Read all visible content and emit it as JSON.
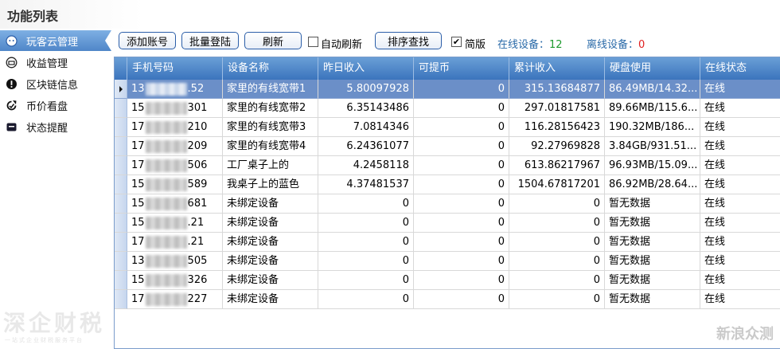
{
  "app": {
    "title": "功能列表"
  },
  "sidebar": {
    "items": [
      {
        "label": "玩客云管理",
        "icon": "cloud-icon",
        "active": true
      },
      {
        "label": "收益管理",
        "icon": "income-icon",
        "active": false
      },
      {
        "label": "区块链信息",
        "icon": "blockchain-info-icon",
        "active": false
      },
      {
        "label": "币价看盘",
        "icon": "price-chart-icon",
        "active": false
      },
      {
        "label": "状态提醒",
        "icon": "notification-icon",
        "active": false
      }
    ],
    "watermark": "深企财税",
    "watermark_sub": "一站式企业财税服务平台"
  },
  "toolbar": {
    "add_account": "添加账号",
    "batch_login": "批量登陆",
    "refresh": "刷新",
    "auto_refresh_label": "自动刷新",
    "auto_refresh_checked": false,
    "sort_search": "排序查找",
    "simple_label": "简版",
    "simple_checked": true,
    "online_label": "在线设备：",
    "online_count": "12",
    "offline_label": "离线设备：",
    "offline_count": "0",
    "online_color": "#1e9a2e",
    "offline_color": "#e02020"
  },
  "table": {
    "headers": [
      "手机号码",
      "设备名称",
      "昨日收入",
      "可提币",
      "累计收入",
      "硬盘使用",
      "在线状态"
    ],
    "rows": [
      {
        "phone_prefix": "13",
        "phone_suffix": ".52",
        "device": "家里的有线宽带1",
        "yesterday": "5.80097928",
        "withdrawable": "0",
        "total": "315.13684877",
        "disk": "86.49MB/14.32...",
        "status": "在线",
        "selected": true
      },
      {
        "phone_prefix": "15",
        "phone_suffix": "301",
        "device": "家里的有线宽带2",
        "yesterday": "6.35143486",
        "withdrawable": "0",
        "total": "297.01817581",
        "disk": "89.66MB/115.6...",
        "status": "在线",
        "selected": false
      },
      {
        "phone_prefix": "17",
        "phone_suffix": "210",
        "device": "家里的有线宽带3",
        "yesterday": "7.0814346",
        "withdrawable": "0",
        "total": "116.28156423",
        "disk": "190.32MB/186...",
        "status": "在线",
        "selected": false
      },
      {
        "phone_prefix": "17",
        "phone_suffix": "209",
        "device": "家里的有线宽带4",
        "yesterday": "6.24361077",
        "withdrawable": "0",
        "total": "92.27969828",
        "disk": "3.84GB/931.51...",
        "status": "在线",
        "selected": false
      },
      {
        "phone_prefix": "17",
        "phone_suffix": "506",
        "device": "工厂桌子上的",
        "yesterday": "4.2458118",
        "withdrawable": "0",
        "total": "613.86217967",
        "disk": "96.93MB/15.09...",
        "status": "在线",
        "selected": false
      },
      {
        "phone_prefix": "15",
        "phone_suffix": "589",
        "device": "我桌子上的蓝色",
        "yesterday": "4.37481537",
        "withdrawable": "0",
        "total": "1504.67817201",
        "disk": "86.92MB/28.64...",
        "status": "在线",
        "selected": false
      },
      {
        "phone_prefix": "15",
        "phone_suffix": "681",
        "device": "未绑定设备",
        "yesterday": "0",
        "withdrawable": "0",
        "total": "0",
        "disk": "暂无数据",
        "status": "在线",
        "selected": false
      },
      {
        "phone_prefix": "15",
        "phone_suffix": ".21",
        "device": "未绑定设备",
        "yesterday": "0",
        "withdrawable": "0",
        "total": "0",
        "disk": "暂无数据",
        "status": "在线",
        "selected": false
      },
      {
        "phone_prefix": "17",
        "phone_suffix": ".21",
        "device": "未绑定设备",
        "yesterday": "0",
        "withdrawable": "0",
        "total": "0",
        "disk": "暂无数据",
        "status": "在线",
        "selected": false
      },
      {
        "phone_prefix": "13",
        "phone_suffix": "505",
        "device": "未绑定设备",
        "yesterday": "0",
        "withdrawable": "0",
        "total": "0",
        "disk": "暂无数据",
        "status": "在线",
        "selected": false
      },
      {
        "phone_prefix": "15",
        "phone_suffix": "326",
        "device": "未绑定设备",
        "yesterday": "0",
        "withdrawable": "0",
        "total": "0",
        "disk": "暂无数据",
        "status": "在线",
        "selected": false
      },
      {
        "phone_prefix": "17",
        "phone_suffix": "227",
        "device": "未绑定设备",
        "yesterday": "0",
        "withdrawable": "0",
        "total": "0",
        "disk": "暂无数据",
        "status": "在线",
        "selected": false
      }
    ]
  },
  "corner_watermark": "新浪众测"
}
